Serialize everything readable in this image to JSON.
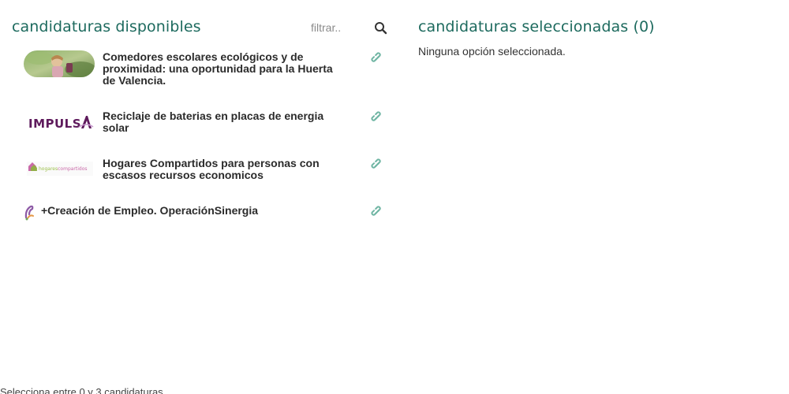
{
  "available": {
    "heading": "candidaturas disponibles",
    "filter_placeholder": "filtrar..",
    "search_icon": "search-icon",
    "items": [
      {
        "title": "Comedores escolares ecológicos y de proximidad: una oportunidad para la Huerta de Valencia.",
        "thumb": "photo-child-with-vegetables",
        "link_icon": "link-icon"
      },
      {
        "title": "Reciclaje de baterias en placas de energia solar",
        "thumb": "impulsa-logo",
        "logo_text": "IMPULSA",
        "link_icon": "link-icon"
      },
      {
        "title": "Hogares Compartidos para personas con escasos recursos economicos",
        "thumb": "hogares-compartidos-logo",
        "logo_text": "hogarescompartidos",
        "link_icon": "link-icon"
      },
      {
        "title": "+Creación de Empleo. OperaciónSinergia",
        "thumb": "sinergia-logo",
        "link_icon": "link-icon"
      }
    ]
  },
  "selected": {
    "heading": "candidaturas seleccionadas (0)",
    "empty_text": "Ninguna opción seleccionada."
  },
  "footer": {
    "text": "Selecciona entre 0 y 3 candidaturas"
  },
  "colors": {
    "heading": "#1d6a5e",
    "link_icon": "#6fb5a3",
    "impulsa_purple": "#5e1a5c"
  }
}
